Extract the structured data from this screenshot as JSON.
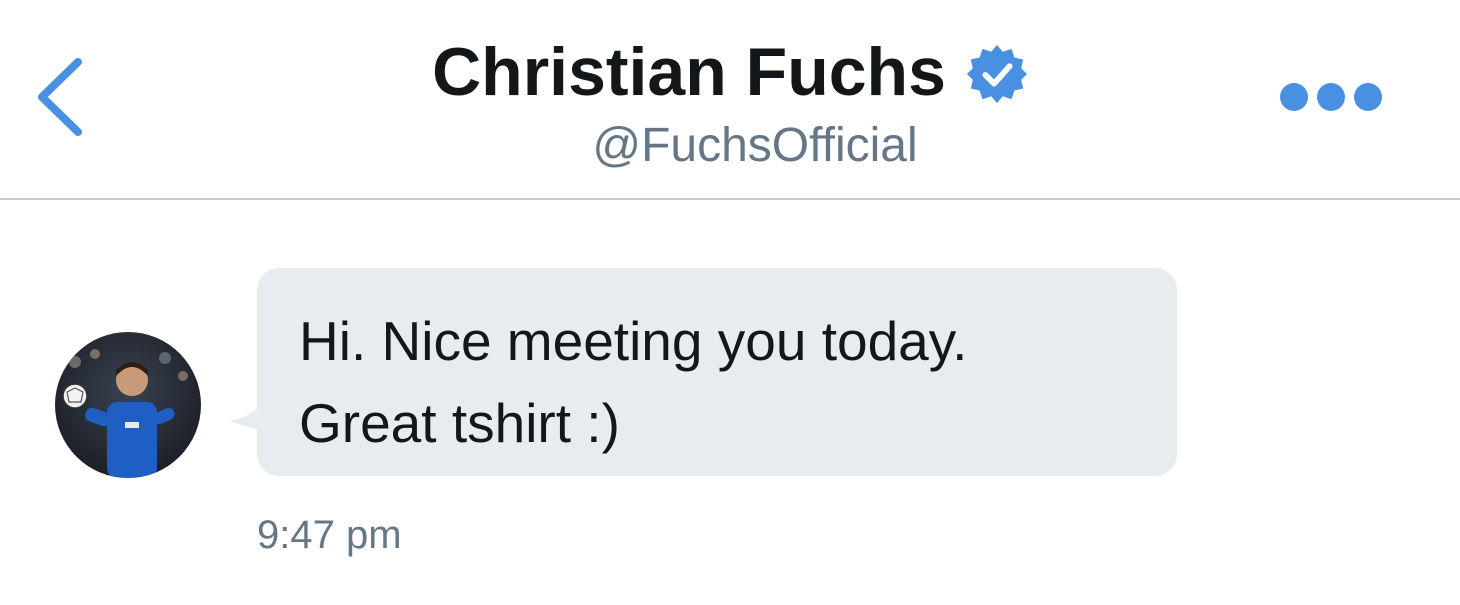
{
  "header": {
    "back_icon": "chevron-left-icon",
    "title": "Christian Fuchs",
    "verified_icon": "verified-badge-icon",
    "handle": "@FuchsOfficial",
    "more_icon": "more-dots-icon",
    "accent_color": "#4a90e2"
  },
  "conversation": {
    "messages": [
      {
        "sender_avatar": "profile-photo",
        "text": "Hi. Nice meeting you today.\nGreat tshirt :)",
        "time": "9:47 pm"
      }
    ]
  },
  "colors": {
    "bubble_bg": "#e6ecf0",
    "text": "#14171a",
    "secondary_text": "#657786",
    "divider": "#c4cbd6"
  }
}
